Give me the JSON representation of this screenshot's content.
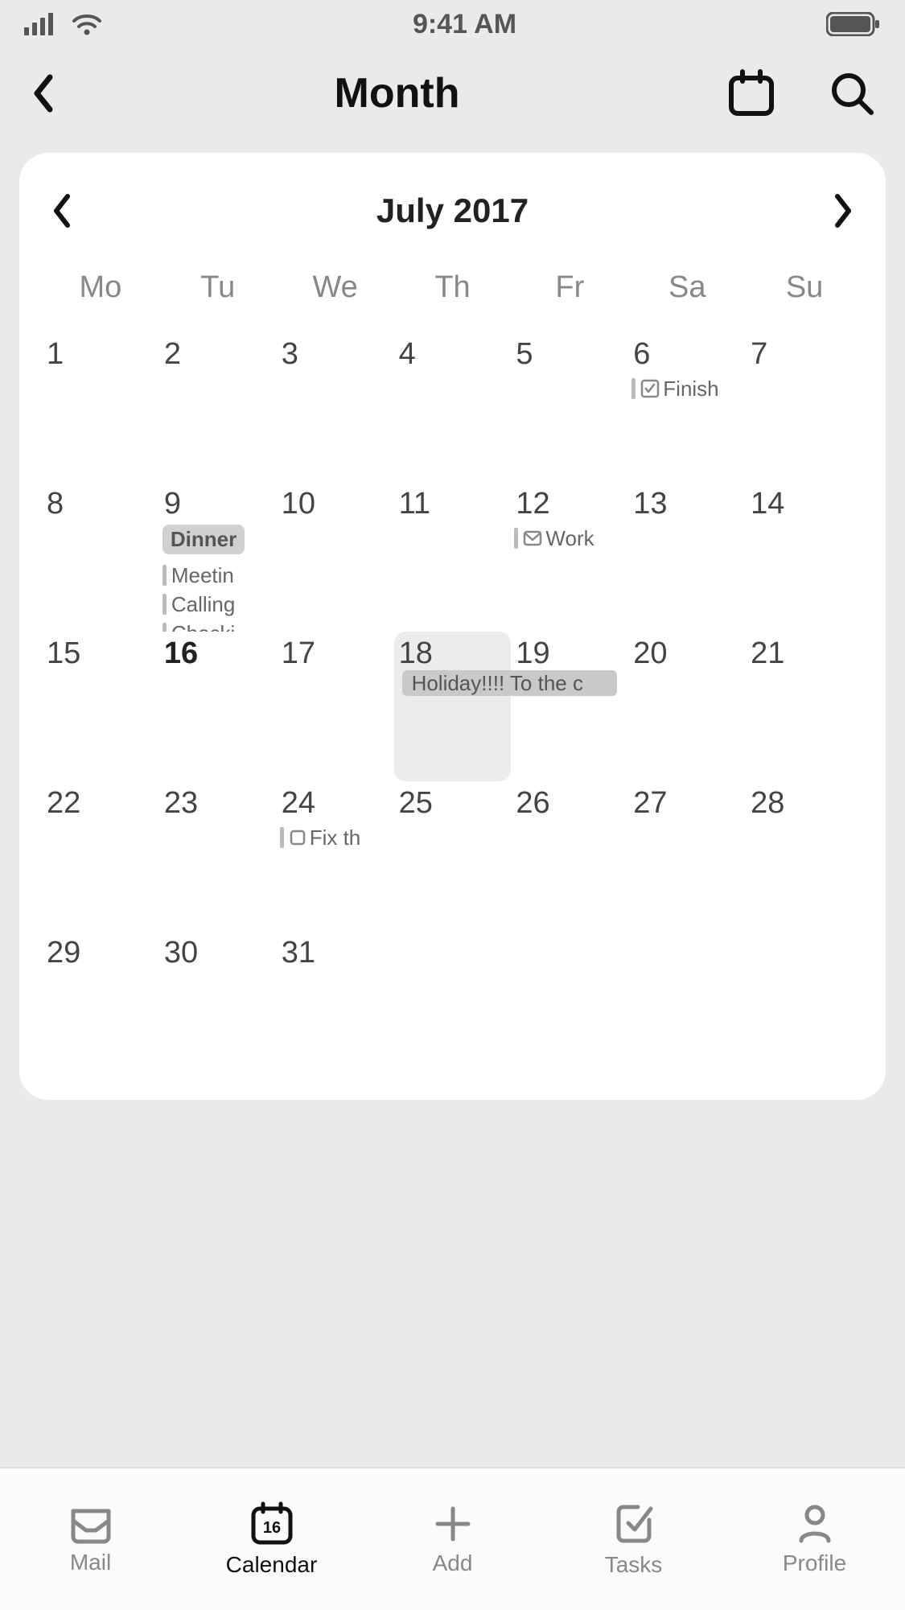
{
  "status": {
    "time": "9:41 AM"
  },
  "nav": {
    "title": "Month"
  },
  "calendar": {
    "month_label": "July 2017",
    "weekdays": [
      "Mo",
      "Tu",
      "We",
      "Th",
      "Fr",
      "Sa",
      "Su"
    ],
    "days": [
      {
        "n": "1"
      },
      {
        "n": "2"
      },
      {
        "n": "3"
      },
      {
        "n": "4"
      },
      {
        "n": "5"
      },
      {
        "n": "6",
        "events": [
          {
            "type": "check",
            "label": "Finish"
          }
        ]
      },
      {
        "n": "7"
      },
      {
        "n": "8"
      },
      {
        "n": "9",
        "pill": "Dinner",
        "events": [
          {
            "type": "bar",
            "label": "Meetin"
          },
          {
            "type": "bar",
            "label": "Calling"
          },
          {
            "type": "bar",
            "label": "Checki"
          }
        ]
      },
      {
        "n": "10"
      },
      {
        "n": "11"
      },
      {
        "n": "12",
        "events": [
          {
            "type": "mail",
            "label": "Work"
          }
        ]
      },
      {
        "n": "13"
      },
      {
        "n": "14"
      },
      {
        "n": "15"
      },
      {
        "n": "16",
        "bold": true
      },
      {
        "n": "17"
      },
      {
        "n": "18",
        "selected": true
      },
      {
        "n": "19"
      },
      {
        "n": "20"
      },
      {
        "n": "21"
      },
      {
        "n": "22"
      },
      {
        "n": "23"
      },
      {
        "n": "24",
        "events": [
          {
            "type": "square",
            "label": "Fix th"
          }
        ]
      },
      {
        "n": "25"
      },
      {
        "n": "26"
      },
      {
        "n": "27"
      },
      {
        "n": "28"
      },
      {
        "n": "29"
      },
      {
        "n": "30"
      },
      {
        "n": "31"
      }
    ],
    "span_event": {
      "label": "Holiday!!!! To the c",
      "row": 2,
      "col_start": 3,
      "col_span": 2
    }
  },
  "tabs": {
    "mail": "Mail",
    "calendar": "Calendar",
    "add": "Add",
    "tasks": "Tasks",
    "profile": "Profile",
    "calendar_day": "16"
  }
}
